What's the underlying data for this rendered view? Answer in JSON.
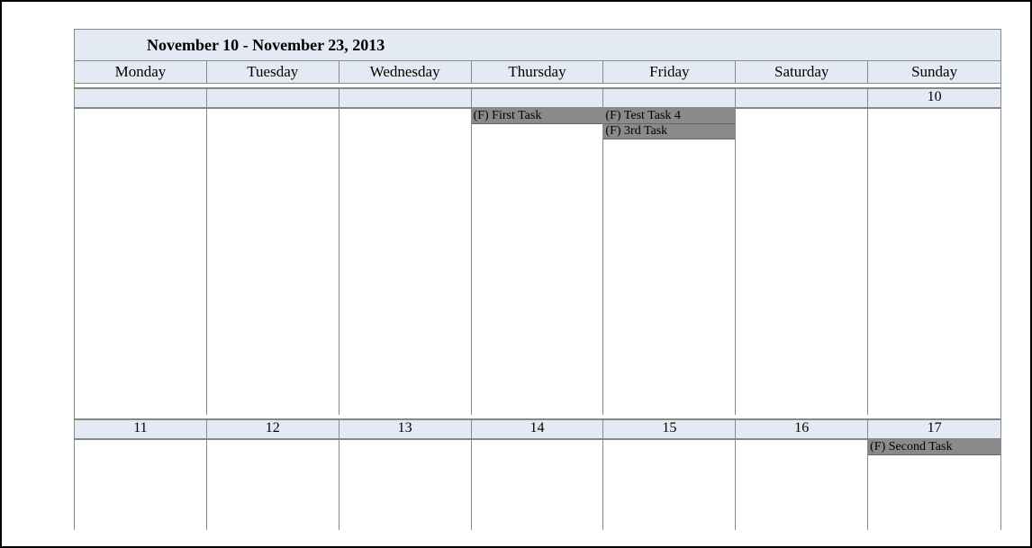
{
  "title": "November 10 - November 23, 2013",
  "weekdays": [
    "Monday",
    "Tuesday",
    "Wednesday",
    "Thursday",
    "Friday",
    "Saturday",
    "Sunday"
  ],
  "week1": {
    "dates": [
      "",
      "",
      "",
      "",
      "",
      "",
      "10"
    ],
    "tasks": {
      "thursday": [
        "(F) First Task"
      ],
      "friday": [
        "(F) Test Task 4",
        "(F) 3rd Task"
      ]
    }
  },
  "week2": {
    "dates": [
      "11",
      "12",
      "13",
      "14",
      "15",
      "16",
      "17"
    ],
    "tasks": {
      "sunday": [
        "(F) Second Task"
      ]
    }
  }
}
